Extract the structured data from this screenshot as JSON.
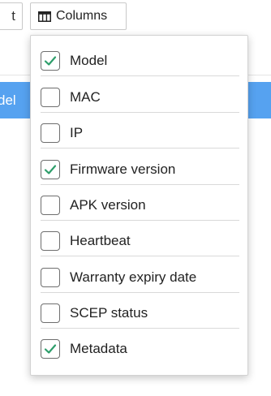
{
  "toolbar": {
    "prev_button_label": "t",
    "columns_button_label": "Columns",
    "columns_icon": "table-columns-icon"
  },
  "table": {
    "header_partial_label": "del",
    "header_color": "#56a2f0"
  },
  "columns_menu": {
    "check_color": "#2e9e6b",
    "items": [
      {
        "label": "Model",
        "checked": true
      },
      {
        "label": "MAC",
        "checked": false
      },
      {
        "label": "IP",
        "checked": false
      },
      {
        "label": "Firmware version",
        "checked": true
      },
      {
        "label": "APK version",
        "checked": false
      },
      {
        "label": "Heartbeat",
        "checked": false
      },
      {
        "label": "Warranty expiry date",
        "checked": false
      },
      {
        "label": "SCEP status",
        "checked": false
      },
      {
        "label": "Metadata",
        "checked": true
      }
    ]
  }
}
